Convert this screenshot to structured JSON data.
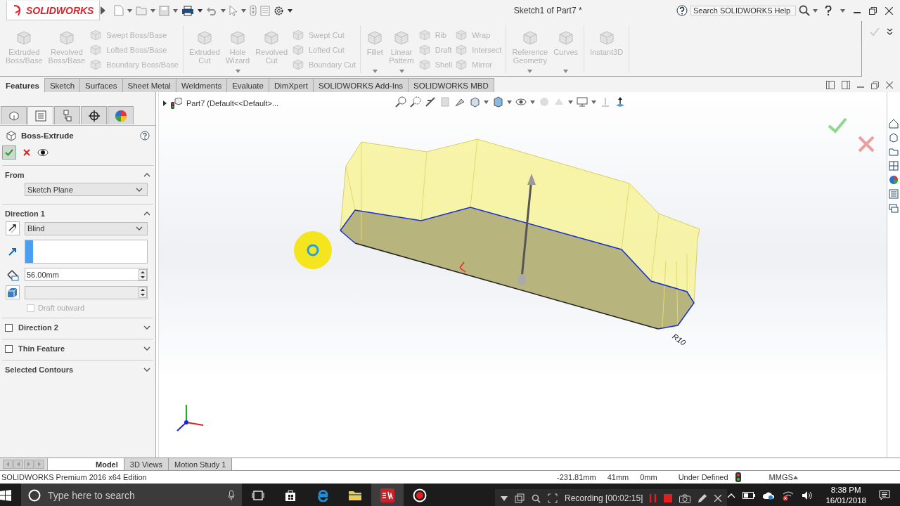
{
  "title_bar": {
    "logo": "SOLIDWORKS",
    "document_title": "Sketch1 of Part7 *",
    "search": {
      "placeholder": "Search SOLIDWORKS Help"
    }
  },
  "ribbon": {
    "groups": [
      {
        "items": [
          {
            "kind": "large",
            "label": "Extruded Boss/Base",
            "disabled": true,
            "dropdown": false
          },
          {
            "kind": "large",
            "label": "Revolved Boss/Base",
            "disabled": true,
            "dropdown": false
          },
          {
            "kind": "column",
            "items": [
              {
                "label": "Swept Boss/Base",
                "disabled": true
              },
              {
                "label": "Lofted Boss/Base",
                "disabled": true
              },
              {
                "label": "Boundary Boss/Base",
                "disabled": true
              }
            ]
          }
        ]
      },
      {
        "items": [
          {
            "kind": "large",
            "label": "Extruded Cut",
            "disabled": true,
            "dropdown": false
          },
          {
            "kind": "large",
            "label": "Hole Wizard",
            "disabled": true,
            "dropdown": true
          },
          {
            "kind": "large",
            "label": "Revolved Cut",
            "disabled": true,
            "dropdown": false
          },
          {
            "kind": "column",
            "items": [
              {
                "label": "Swept Cut",
                "disabled": true
              },
              {
                "label": "Lofted Cut",
                "disabled": true
              },
              {
                "label": "Boundary Cut",
                "disabled": true
              }
            ]
          }
        ]
      },
      {
        "items": [
          {
            "kind": "large",
            "label": "Fillet",
            "disabled": true,
            "dropdown": true
          },
          {
            "kind": "large",
            "label": "Linear Pattern",
            "disabled": true,
            "dropdown": true
          },
          {
            "kind": "column",
            "items": [
              {
                "label": "Rib",
                "disabled": true
              },
              {
                "label": "Draft",
                "disabled": true
              },
              {
                "label": "Shell",
                "disabled": true
              }
            ]
          },
          {
            "kind": "column",
            "items": [
              {
                "label": "Wrap",
                "disabled": true
              },
              {
                "label": "Intersect",
                "disabled": true
              },
              {
                "label": "Mirror",
                "disabled": true
              }
            ]
          }
        ]
      },
      {
        "items": [
          {
            "kind": "large",
            "label": "Reference Geometry",
            "disabled": true,
            "dropdown": true
          },
          {
            "kind": "large",
            "label": "Curves",
            "disabled": true,
            "dropdown": true
          }
        ]
      },
      {
        "items": [
          {
            "kind": "large",
            "label": "Instant3D",
            "disabled": true,
            "dropdown": false
          }
        ]
      }
    ]
  },
  "command_tabs": [
    {
      "label": "Features",
      "selected": true
    },
    {
      "label": "Sketch",
      "selected": false
    },
    {
      "label": "Surfaces",
      "selected": false
    },
    {
      "label": "Sheet Metal",
      "selected": false
    },
    {
      "label": "Weldments",
      "selected": false
    },
    {
      "label": "Evaluate",
      "selected": false
    },
    {
      "label": "DimXpert",
      "selected": false
    },
    {
      "label": "SOLIDWORKS Add-Ins",
      "selected": false
    },
    {
      "label": "SOLIDWORKS MBD",
      "selected": false
    }
  ],
  "property_manager": {
    "tabs": [
      {
        "kind": "feature_tree",
        "selected": false
      },
      {
        "kind": "property_manager",
        "selected": true
      },
      {
        "kind": "configuration",
        "selected": false
      },
      {
        "kind": "dimxpert",
        "selected": false
      },
      {
        "kind": "display",
        "selected": false
      }
    ],
    "title": "Boss-Extrude",
    "sections": [
      {
        "kind": "from",
        "title": "From",
        "expanded": true,
        "start": "Sketch Plane"
      },
      {
        "kind": "direction",
        "title": "Direction 1",
        "expanded": true,
        "end_condition": "Blind",
        "depth": "56.00mm",
        "draft_outward": {
          "label": "Draft outward",
          "checked": false,
          "disabled": true
        }
      },
      {
        "kind": "option",
        "title": "Direction 2",
        "checked": false,
        "expanded": false
      },
      {
        "kind": "option",
        "title": "Thin Feature",
        "checked": false,
        "expanded": false
      },
      {
        "kind": "plain",
        "title": "Selected Contours",
        "expanded": false
      }
    ]
  },
  "graphics": {
    "breadcrumb": "Part7 (Default<<Default>...",
    "dimension": "R10"
  },
  "bottom_tabs": [
    {
      "label": "Model",
      "selected": true
    },
    {
      "label": "3D Views",
      "selected": false
    },
    {
      "label": "Motion Study 1",
      "selected": false
    }
  ],
  "status_bar": {
    "edition": "SOLIDWORKS Premium 2016 x64 Edition",
    "coordinates": [
      "-231.81mm",
      "41mm",
      "0mm"
    ],
    "state": "Under Defined",
    "units": "MMGS"
  },
  "taskbar": {
    "search": {
      "placeholder": "Type here to search"
    },
    "recording": "Recording [00:02:15]",
    "time": "8:38 PM",
    "date": "16/01/2018"
  }
}
